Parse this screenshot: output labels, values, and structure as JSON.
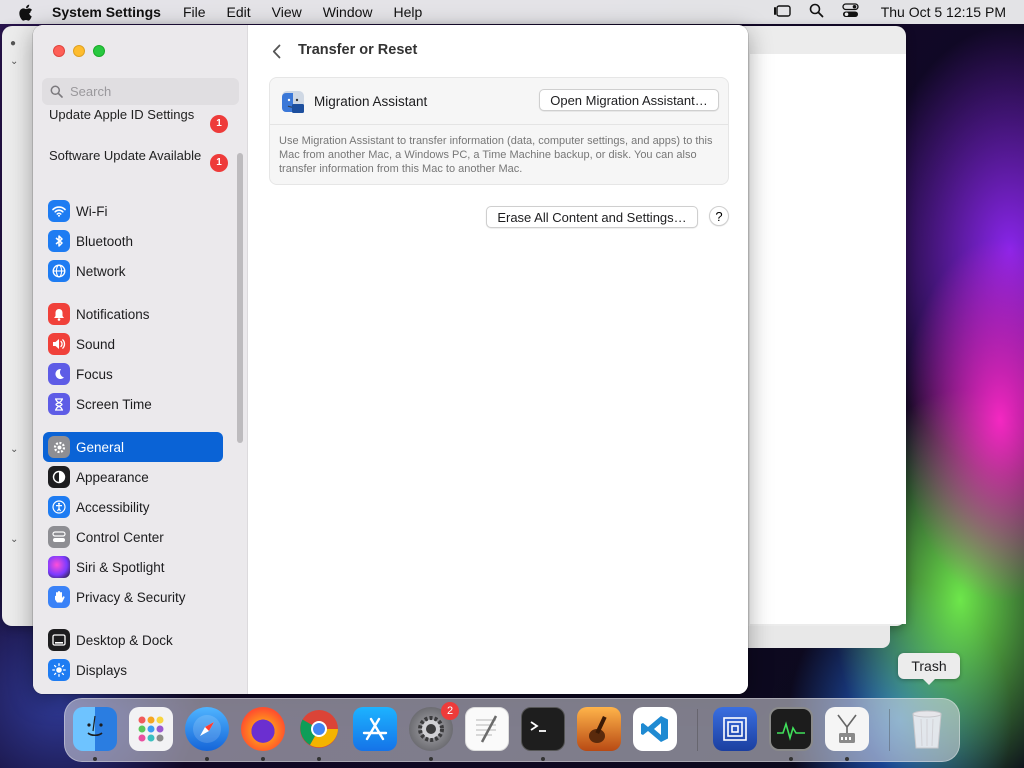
{
  "menubar": {
    "app_name": "System Settings",
    "menus": [
      "File",
      "Edit",
      "View",
      "Window",
      "Help"
    ],
    "clock": "Thu Oct 5  12:15 PM"
  },
  "sidebar": {
    "search_placeholder": "Search",
    "notices": [
      {
        "label": "Update Apple ID Settings",
        "badge": "1"
      },
      {
        "label": "Software Update Available",
        "badge": "1"
      }
    ],
    "items": [
      {
        "label": "Wi-Fi",
        "icon": "wifi-icon",
        "color": "#1e7cf2"
      },
      {
        "label": "Bluetooth",
        "icon": "bluetooth-icon",
        "color": "#1e7cf2"
      },
      {
        "label": "Network",
        "icon": "globe-icon",
        "color": "#1e7cf2"
      },
      {
        "label": "Notifications",
        "icon": "bell-icon",
        "color": "#f0413a"
      },
      {
        "label": "Sound",
        "icon": "speaker-icon",
        "color": "#f0413a"
      },
      {
        "label": "Focus",
        "icon": "moon-icon",
        "color": "#5e5ce6"
      },
      {
        "label": "Screen Time",
        "icon": "hourglass-icon",
        "color": "#5e5ce6"
      },
      {
        "label": "General",
        "icon": "gear-icon",
        "color": "#8e8e93",
        "selected": true
      },
      {
        "label": "Appearance",
        "icon": "appearance-icon",
        "color": "#1d1d1f"
      },
      {
        "label": "Accessibility",
        "icon": "accessibility-icon",
        "color": "#1e7cf2"
      },
      {
        "label": "Control Center",
        "icon": "control-center-icon",
        "color": "#8e8e93"
      },
      {
        "label": "Siri & Spotlight",
        "icon": "siri-icon",
        "color": "#b04fe0"
      },
      {
        "label": "Privacy & Security",
        "icon": "hand-icon",
        "color": "#3a82f7"
      },
      {
        "label": "Desktop & Dock",
        "icon": "dock-icon",
        "color": "#1d1d1f"
      },
      {
        "label": "Displays",
        "icon": "sun-icon",
        "color": "#1e7cf2"
      }
    ]
  },
  "content": {
    "title": "Transfer or Reset",
    "migration": {
      "title": "Migration Assistant",
      "button": "Open Migration Assistant…",
      "description": "Use Migration Assistant to transfer information (data, computer settings, and apps) to this Mac from another Mac, a Windows PC, a Time Machine backup, or disk. You can also transfer information from this Mac to another Mac."
    },
    "erase_button": "Erase All Content and Settings…",
    "help_label": "?"
  },
  "tooltip": "Trash",
  "dock": {
    "settings_badge": "2",
    "apps": [
      "finder-icon",
      "launchpad-icon",
      "safari-icon",
      "firefox-icon",
      "chrome-icon",
      "app-store-icon",
      "system-settings-icon",
      "textedit-icon",
      "terminal-icon",
      "garageband-icon",
      "vscode-icon",
      "app-icon",
      "activity-monitor-icon",
      "system-information-icon",
      "trash-icon"
    ]
  }
}
